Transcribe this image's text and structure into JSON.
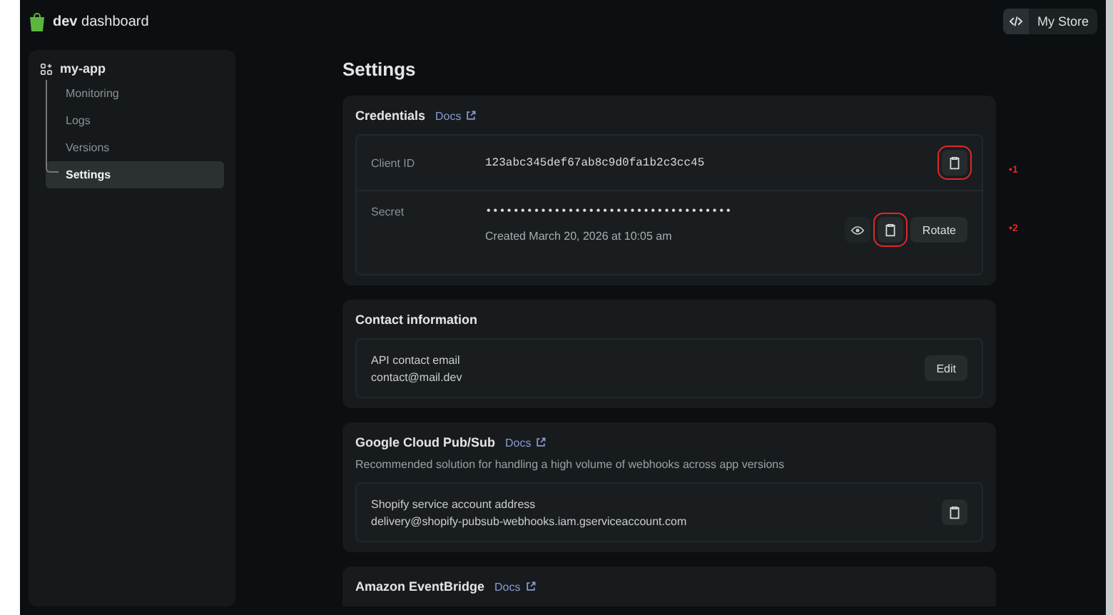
{
  "topbar": {
    "brand_bold": "dev",
    "brand": "dashboard",
    "store_button": "My Store"
  },
  "sidebar": {
    "app": "my-app",
    "items": [
      {
        "label": "Monitoring",
        "selected": false
      },
      {
        "label": "Logs",
        "selected": false
      },
      {
        "label": "Versions",
        "selected": false
      },
      {
        "label": "Settings",
        "selected": true
      }
    ]
  },
  "page_title": "Settings",
  "credentials": {
    "title": "Credentials",
    "docs": "Docs",
    "client_id": {
      "label": "Client ID",
      "value": "123abc345def67ab8c9d0fa1b2c3cc45",
      "copy_highlighted": true,
      "annotation": "•1"
    },
    "secret": {
      "label": "Secret",
      "value": "••••••••••••••••••••••••••••••••••••",
      "created": "Created March 20, 2026 at 10:05 am",
      "copy_highlighted": true,
      "rotate": "Rotate",
      "annotation": "•2"
    }
  },
  "contact": {
    "title": "Contact information",
    "label": "API contact email",
    "value": "contact@mail.dev",
    "edit": "Edit"
  },
  "pubsub": {
    "title": "Google Cloud Pub/Sub",
    "docs": "Docs",
    "description": "Recommended solution for handling a high volume of webhooks across app versions",
    "label": "Shopify service account address",
    "value": "delivery@shopify-pubsub-webhooks.iam.gserviceaccount.com",
    "copy_highlighted": false
  },
  "eventbridge": {
    "title": "Amazon EventBridge",
    "docs": "Docs"
  }
}
